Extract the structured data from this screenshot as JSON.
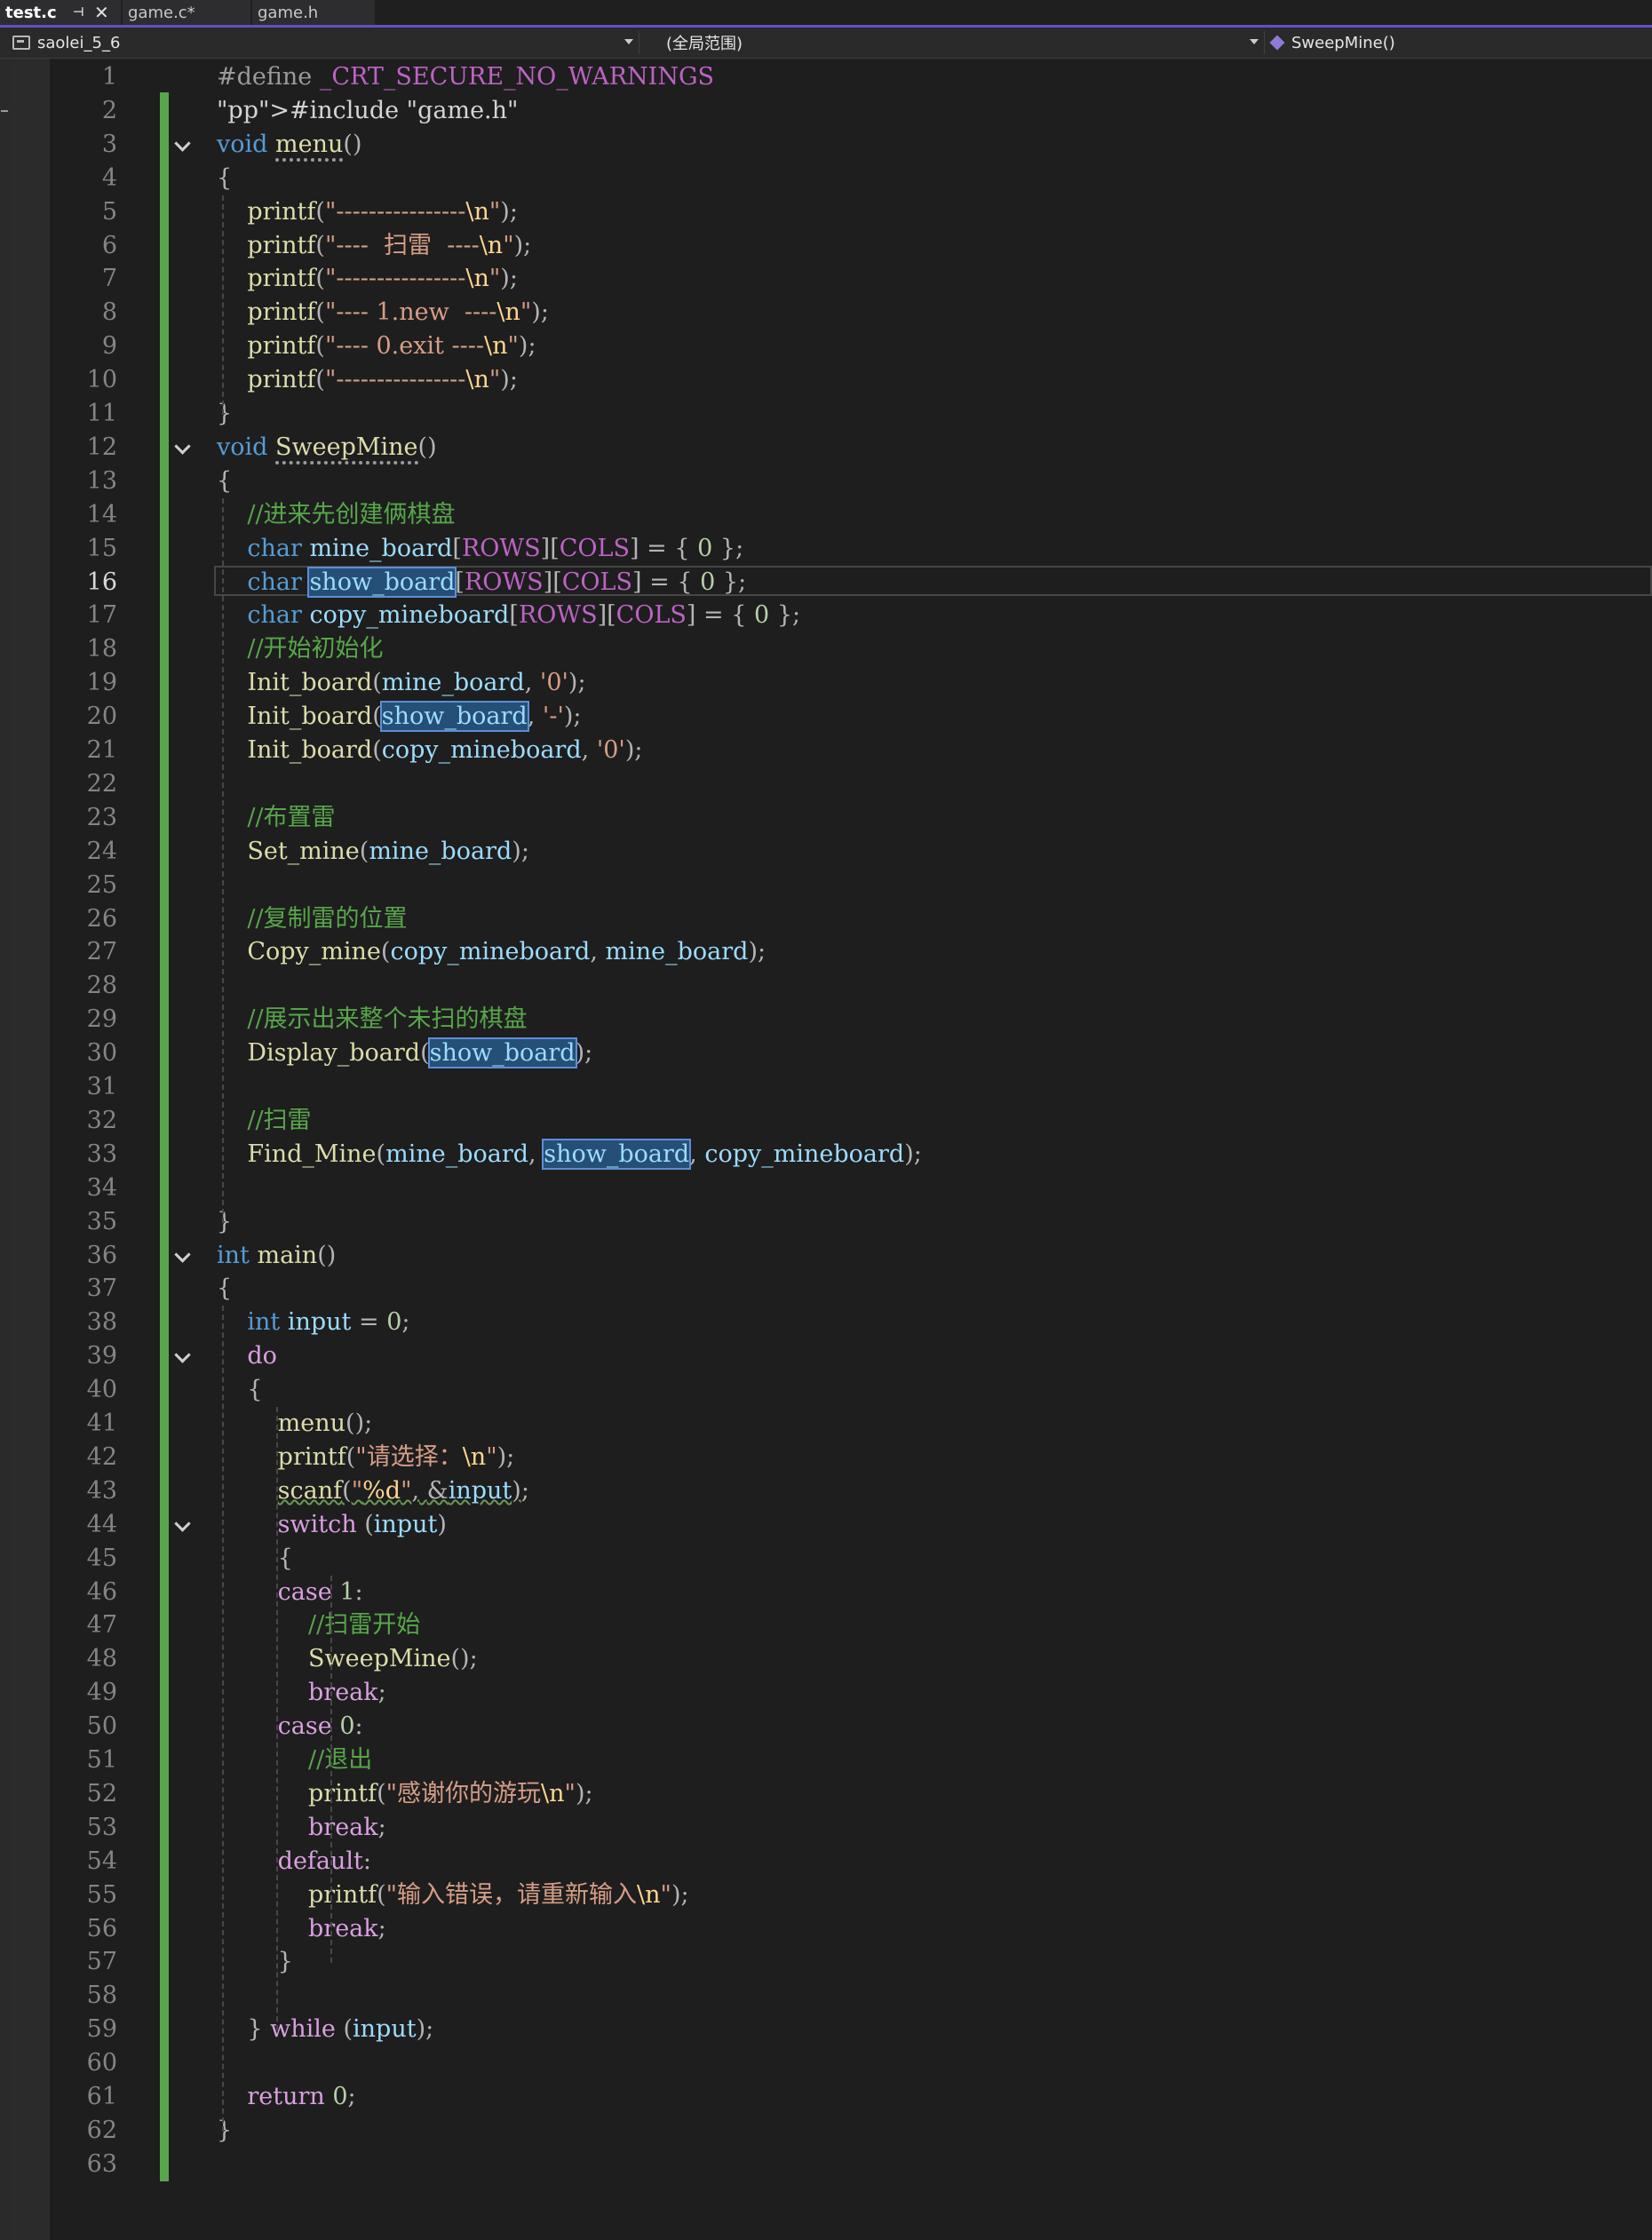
{
  "tabs": [
    {
      "label": "test.c",
      "active": true
    },
    {
      "label": "game.c*"
    },
    {
      "label": "game.h"
    }
  ],
  "nav": {
    "project": "saolei_5_6",
    "scope": "(全局范围)",
    "function": "SweepMine()"
  },
  "current_line": 16,
  "lines": [
    {
      "n": "1",
      "code": "#define _CRT_SECURE_NO_WARNINGS"
    },
    {
      "n": "2",
      "code": "#include \"game.h\""
    },
    {
      "n": "3",
      "code": "void menu()"
    },
    {
      "n": "4",
      "code": "{"
    },
    {
      "n": "5",
      "code": "    printf(\"----------------\\n\");"
    },
    {
      "n": "6",
      "code": "    printf(\"----  扫雷  ----\\n\");"
    },
    {
      "n": "7",
      "code": "    printf(\"----------------\\n\");"
    },
    {
      "n": "8",
      "code": "    printf(\"---- 1.new  ----\\n\");"
    },
    {
      "n": "9",
      "code": "    printf(\"---- 0.exit ----\\n\");"
    },
    {
      "n": "10",
      "code": "    printf(\"----------------\\n\");"
    },
    {
      "n": "11",
      "code": "}"
    },
    {
      "n": "12",
      "code": "void SweepMine()"
    },
    {
      "n": "13",
      "code": "{"
    },
    {
      "n": "14",
      "code": "    //进来先创建俩棋盘"
    },
    {
      "n": "15",
      "code": "    char mine_board[ROWS][COLS] = { 0 };"
    },
    {
      "n": "16",
      "code": "    char show_board[ROWS][COLS] = { 0 };"
    },
    {
      "n": "17",
      "code": "    char copy_mineboard[ROWS][COLS] = { 0 };"
    },
    {
      "n": "18",
      "code": "    //开始初始化"
    },
    {
      "n": "19",
      "code": "    Init_board(mine_board, '0');"
    },
    {
      "n": "20",
      "code": "    Init_board(show_board, '-');"
    },
    {
      "n": "21",
      "code": "    Init_board(copy_mineboard, '0');"
    },
    {
      "n": "22",
      "code": ""
    },
    {
      "n": "23",
      "code": "    //布置雷"
    },
    {
      "n": "24",
      "code": "    Set_mine(mine_board);"
    },
    {
      "n": "25",
      "code": ""
    },
    {
      "n": "26",
      "code": "    //复制雷的位置"
    },
    {
      "n": "27",
      "code": "    Copy_mine(copy_mineboard, mine_board);"
    },
    {
      "n": "28",
      "code": ""
    },
    {
      "n": "29",
      "code": "    //展示出来整个未扫的棋盘"
    },
    {
      "n": "30",
      "code": "    Display_board(show_board);"
    },
    {
      "n": "31",
      "code": ""
    },
    {
      "n": "32",
      "code": "    //扫雷"
    },
    {
      "n": "33",
      "code": "    Find_Mine(mine_board, show_board, copy_mineboard);"
    },
    {
      "n": "34",
      "code": ""
    },
    {
      "n": "35",
      "code": "}"
    },
    {
      "n": "36",
      "code": "int main()"
    },
    {
      "n": "37",
      "code": "{"
    },
    {
      "n": "38",
      "code": "    int input = 0;"
    },
    {
      "n": "39",
      "code": "    do"
    },
    {
      "n": "40",
      "code": "    {"
    },
    {
      "n": "41",
      "code": "        menu();"
    },
    {
      "n": "42",
      "code": "        printf(\"请选择：\\n\");"
    },
    {
      "n": "43",
      "code": "        scanf(\"%d\", &input);"
    },
    {
      "n": "44",
      "code": "        switch (input)"
    },
    {
      "n": "45",
      "code": "        {"
    },
    {
      "n": "46",
      "code": "        case 1:"
    },
    {
      "n": "47",
      "code": "            //扫雷开始"
    },
    {
      "n": "48",
      "code": "            SweepMine();"
    },
    {
      "n": "49",
      "code": "            break;"
    },
    {
      "n": "50",
      "code": "        case 0:"
    },
    {
      "n": "51",
      "code": "            //退出"
    },
    {
      "n": "52",
      "code": "            printf(\"感谢你的游玩\\n\");"
    },
    {
      "n": "53",
      "code": "            break;"
    },
    {
      "n": "54",
      "code": "        default:"
    },
    {
      "n": "55",
      "code": "            printf(\"输入错误，请重新输入\\n\");"
    },
    {
      "n": "56",
      "code": "            break;"
    },
    {
      "n": "57",
      "code": "        }"
    },
    {
      "n": "58",
      "code": ""
    },
    {
      "n": "59",
      "code": "    } while (input);"
    },
    {
      "n": "60",
      "code": ""
    },
    {
      "n": "61",
      "code": "    return 0;"
    },
    {
      "n": "62",
      "code": "}"
    },
    {
      "n": "63",
      "code": ""
    }
  ],
  "colors": {
    "editor_bg": "#1e1e1e",
    "change_bar": "#57a64a",
    "keyword": "#569cd6",
    "control": "#d8a0df",
    "function": "#dcdcaa",
    "variable": "#9cdcfe",
    "string": "#d69d85",
    "comment": "#57a64a",
    "number": "#b5cea8",
    "highlight": "#264f78"
  },
  "icons": [
    "pin-icon",
    "close-icon",
    "project-icon",
    "function-icon",
    "dropdown-caret-icon",
    "fold-chevron-icon"
  ]
}
